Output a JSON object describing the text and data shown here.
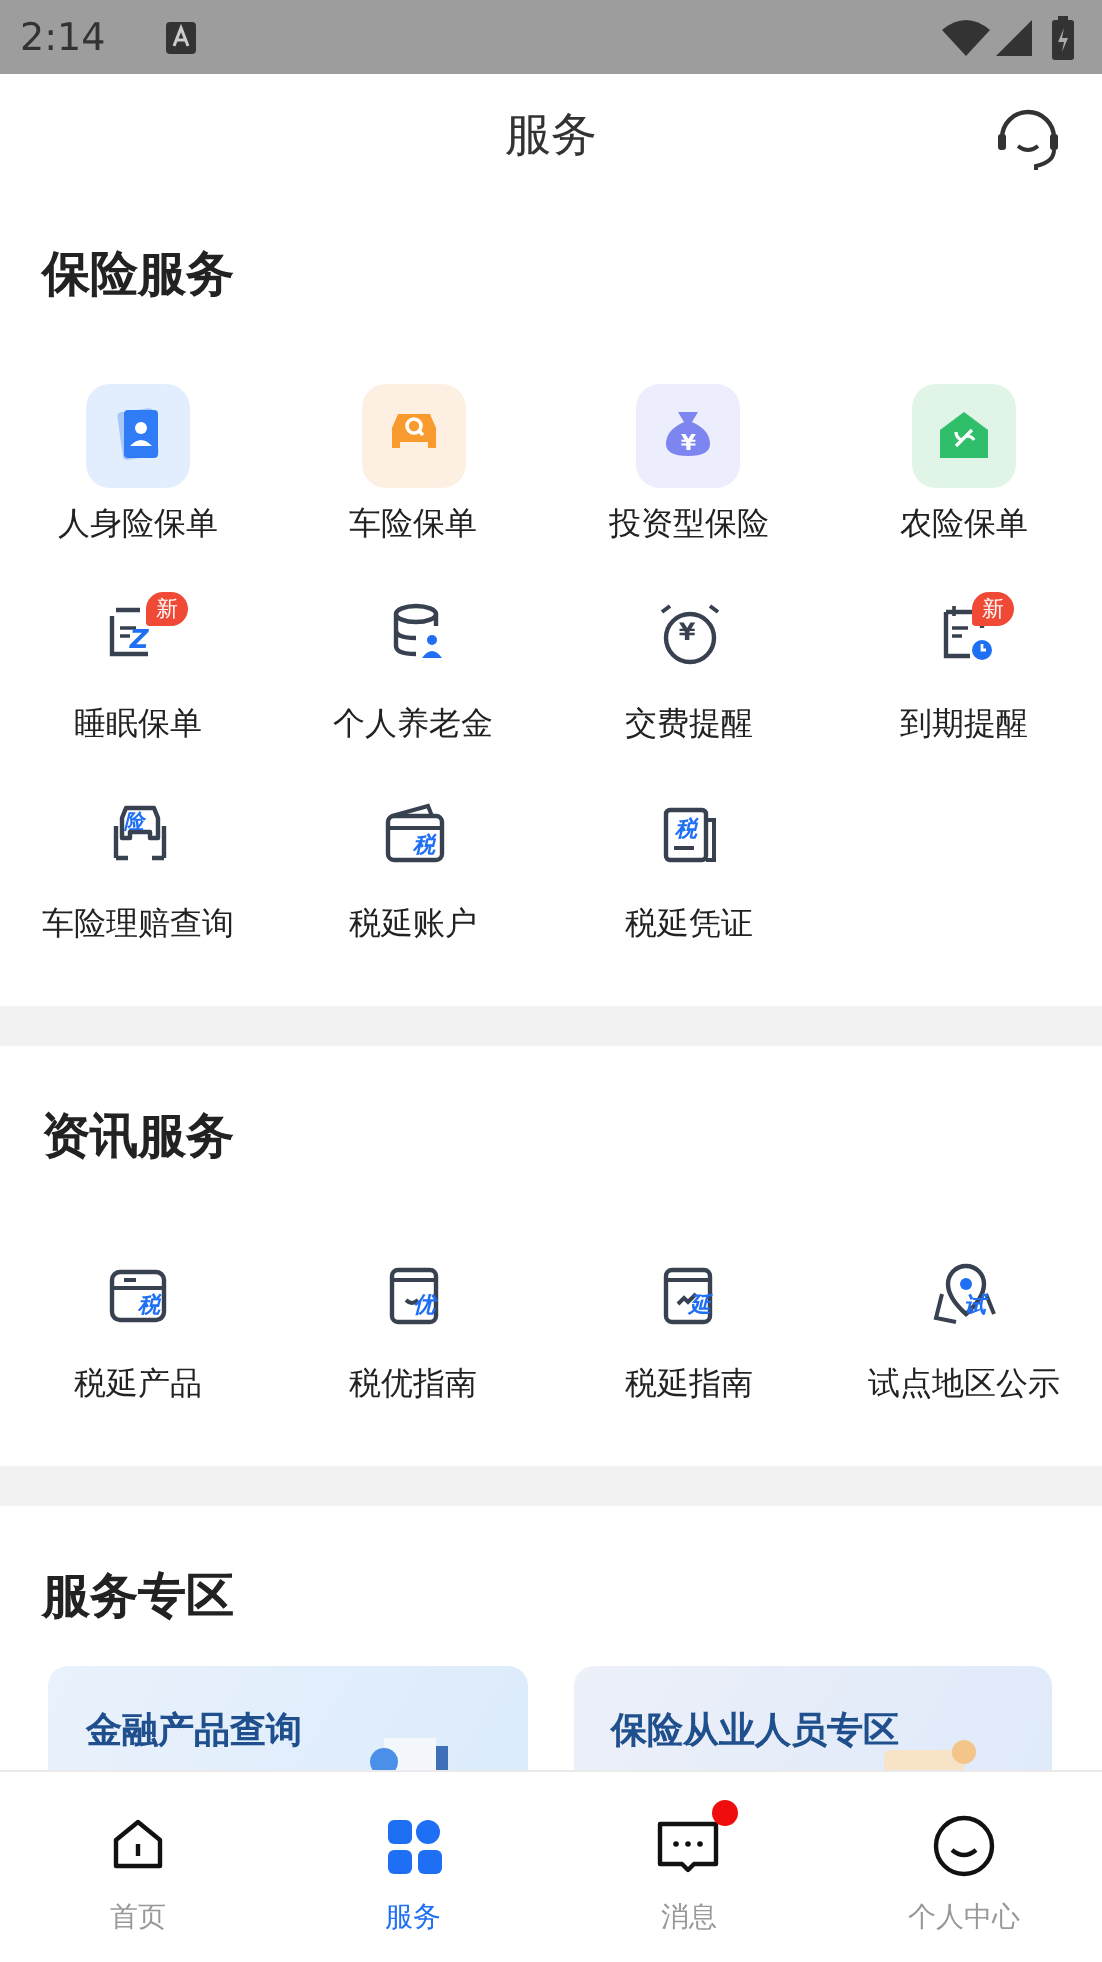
{
  "status_bar": {
    "time": "2:14"
  },
  "header": {
    "title": "服务"
  },
  "sections": [
    {
      "title": "保险服务",
      "items": [
        {
          "label": "人身险保单",
          "kind": "tile"
        },
        {
          "label": "车险保单",
          "kind": "tile"
        },
        {
          "label": "投资型保险",
          "kind": "tile",
          "icon_text": "¥"
        },
        {
          "label": "农险保单",
          "kind": "tile"
        },
        {
          "label": "睡眠保单",
          "kind": "line",
          "badge": "新",
          "icon_text": "Z"
        },
        {
          "label": "个人养老金",
          "kind": "line"
        },
        {
          "label": "交费提醒",
          "kind": "line",
          "icon_text": "¥"
        },
        {
          "label": "到期提醒",
          "kind": "line",
          "badge": "新"
        },
        {
          "label": "车险理赔查询",
          "kind": "line",
          "icon_text": "险"
        },
        {
          "label": "税延账户",
          "kind": "line",
          "icon_text": "税"
        },
        {
          "label": "税延凭证",
          "kind": "line",
          "icon_text": "税"
        }
      ]
    },
    {
      "title": "资讯服务",
      "items": [
        {
          "label": "税延产品",
          "kind": "line",
          "icon_text": "税"
        },
        {
          "label": "税优指南",
          "kind": "line",
          "icon_text": "优"
        },
        {
          "label": "税延指南",
          "kind": "line",
          "icon_text": "延"
        },
        {
          "label": "试点地区公示",
          "kind": "line",
          "icon_text": "试"
        }
      ]
    },
    {
      "title": "服务专区",
      "cards": [
        {
          "title": "金融产品查询"
        },
        {
          "title": "保险从业人员专区"
        }
      ]
    }
  ],
  "bottom_nav": [
    {
      "label": "首页",
      "selected": false,
      "unread": false
    },
    {
      "label": "服务",
      "selected": true,
      "unread": false
    },
    {
      "label": "消息",
      "selected": false,
      "unread": true
    },
    {
      "label": "个人中心",
      "selected": false,
      "unread": false
    }
  ]
}
